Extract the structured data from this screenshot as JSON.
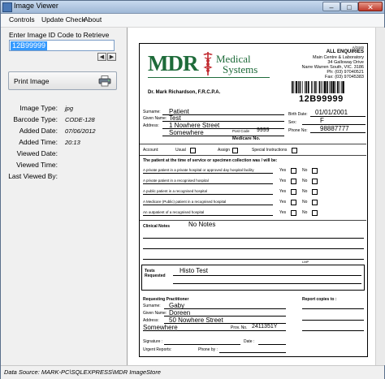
{
  "window": {
    "title": "Image Viewer",
    "minimize": "–",
    "maximize": "□",
    "close": "✕"
  },
  "menu": [
    "Controls",
    "Update Check",
    "About"
  ],
  "left": {
    "retrieve_label": "Enter Image ID Code to Retrieve",
    "id_value": "12B99999",
    "prev_glyph": "◀",
    "next_glyph": "▶",
    "print_label": "Print Image",
    "info": [
      {
        "key": "Image Type:",
        "value": "jpg"
      },
      {
        "key": "Barcode Type:",
        "value": "CODE-128"
      },
      {
        "key": "Added Date:",
        "value": "07/06/2012"
      },
      {
        "key": "Added Time:",
        "value": "20:13"
      },
      {
        "key": "Viewed Date:",
        "value": ""
      },
      {
        "key": "Viewed Time:",
        "value": ""
      },
      {
        "key": "Last Viewed By:",
        "value": ""
      }
    ]
  },
  "document": {
    "logo_mdr": "MDR",
    "logo_medical": "Medical",
    "logo_systems": "Systems",
    "doctor": "Dr. Mark Richardson, F.R.C.P.A.",
    "form_code": "A/3446",
    "lab_name": "ALL ENQUIRIES",
    "lab_lines": [
      "Main Centre & Laboratory",
      "34 Galloway Drive",
      "Narre Warren South, VIC. 3186",
      "Ph: (03) 97040521",
      "Fax: (03) 97045383"
    ],
    "barcode_id": "12B99999",
    "surname_label": "Surname:",
    "given_label": "Given Name:",
    "address_label": "Address:",
    "birth_label": "Birth Date:",
    "sex_label": "Sex:",
    "phone_label": "Phone No:",
    "postcode_label": "Post Code",
    "medicare_label": "Medicare No.",
    "surname": "Patient",
    "given": "Test",
    "address1": "1 Nowhere Street",
    "address2": "Somewhere",
    "postcode": "9999",
    "birth": "01/01/2001",
    "sex": "F",
    "phone": "98887777",
    "account_label": "Account:",
    "acct_opts": [
      "Usual",
      "Assign",
      "Special Instructions"
    ],
    "patient_q": "The patient at the time of service or specimen collection was / will be:",
    "questions": [
      "A private patient in a private hospital or approved day hospital facility",
      "A private patient in a recognised hospital",
      "A public patient in a recognised hospital",
      "A Medicare (Public) patient in a recognised hospital",
      "An outpatient of a recognised hospital"
    ],
    "yes": "Yes",
    "no": "No",
    "clinical_label": "Clinical Notes",
    "clinical_value": "No Notes",
    "lmp": "LMP",
    "tests_label": "Tests Requested",
    "tests_value": "Histo Test",
    "requesting_label": "Requesting Practitioner",
    "report_label": "Report copies to :",
    "req_surname": "Gaby",
    "req_given": "Doreen",
    "req_address": "50 Nowhere Street",
    "req_suburb": "Somewhere",
    "prov_label": "Prov. No.",
    "prov_value": "2411351Y",
    "signature_label": "Signature :",
    "date_label": "Date :",
    "urgent_label": "Urgent Reports:",
    "phone_by_label": "Phone by :"
  },
  "status": {
    "text": "Data Source: MARK-PC\\SQLEXPRESS\\MDR ImageStore"
  },
  "colors": {
    "logo_green": "#1e6b3a",
    "logo_red": "#c0262c",
    "selection": "#3399ff"
  }
}
